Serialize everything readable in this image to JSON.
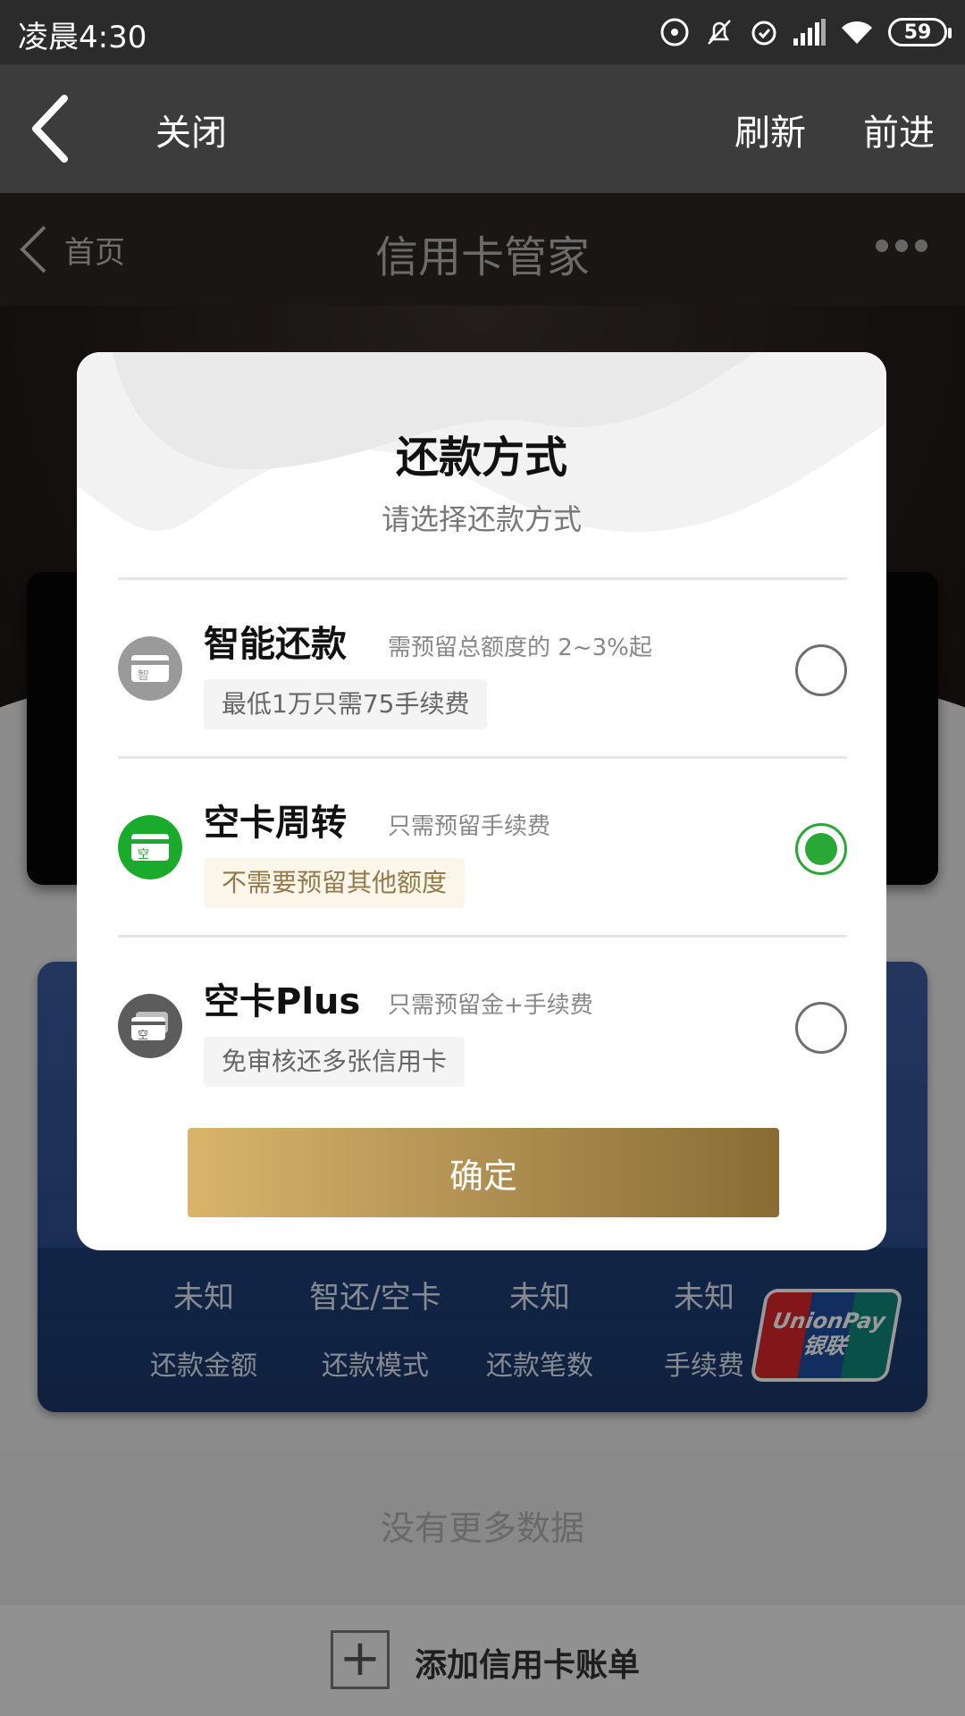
{
  "status_bar": {
    "time": "凌晨4:30",
    "battery": "59"
  },
  "toolbar": {
    "close_label": "关闭",
    "refresh_label": "刷新",
    "forward_label": "前进"
  },
  "page_header": {
    "back_label": "首页",
    "title": "信用卡管家"
  },
  "card": {
    "stats": [
      {
        "value": "未知",
        "label": "还款金额"
      },
      {
        "value": "智还/空卡",
        "label": "还款模式"
      },
      {
        "value": "未知",
        "label": "还款笔数"
      },
      {
        "value": "未知",
        "label": "手续费"
      }
    ],
    "logo_text_en": "UnionPay",
    "logo_text_cn": "银联"
  },
  "footer": {
    "no_more": "没有更多数据",
    "add_label": "添加信用卡账单"
  },
  "modal": {
    "title": "还款方式",
    "subtitle": "请选择还款方式",
    "options": [
      {
        "name": "智能还款",
        "desc": "需预留总额度的 2~3%起",
        "tag": "最低1万只需75手续费",
        "icon_char": "智",
        "icon_color": "#9a9a9a",
        "selected": false
      },
      {
        "name": "空卡周转",
        "desc": "只需预留手续费",
        "tag": "不需要预留其他额度",
        "icon_char": "空",
        "icon_color": "#1aaa2c",
        "selected": true
      },
      {
        "name": "空卡Plus",
        "desc": "只需预留金+手续费",
        "tag": "免审核还多张信用卡",
        "icon_char": "空",
        "icon_color": "#5c5c5c",
        "selected": false
      }
    ],
    "confirm_label": "确定"
  },
  "colors": {
    "accent_green": "#2aa835",
    "confirm_gold_start": "#d9b56b",
    "confirm_gold_end": "#8a6c32"
  }
}
